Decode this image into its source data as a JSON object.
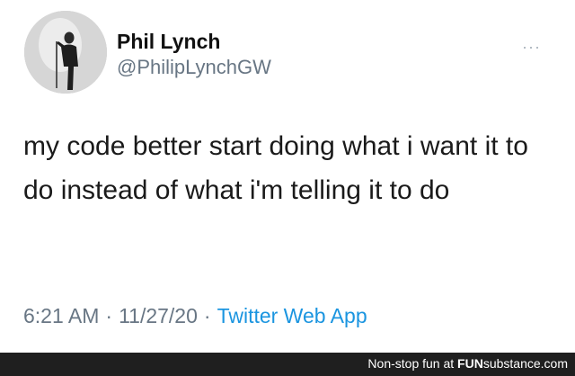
{
  "tweet": {
    "display_name": "Phil Lynch",
    "handle": "@PhilipLynchGW",
    "more_icon": "more-options-icon",
    "more_glyph": "···",
    "text": "my code better start doing what i want it to do instead of what i'm telling it to do",
    "time": "6:21 AM",
    "separator_1": "·",
    "date": "11/27/20",
    "separator_2": "·",
    "source": "Twitter Web App"
  },
  "watermark": {
    "prefix": "Non-stop fun at ",
    "brand_fun": "FUN",
    "brand_rest": "substance.com"
  },
  "colors": {
    "text_primary": "#111111",
    "text_secondary": "#687684",
    "link": "#1b95e0",
    "footer_bg": "#1f1f1f"
  }
}
